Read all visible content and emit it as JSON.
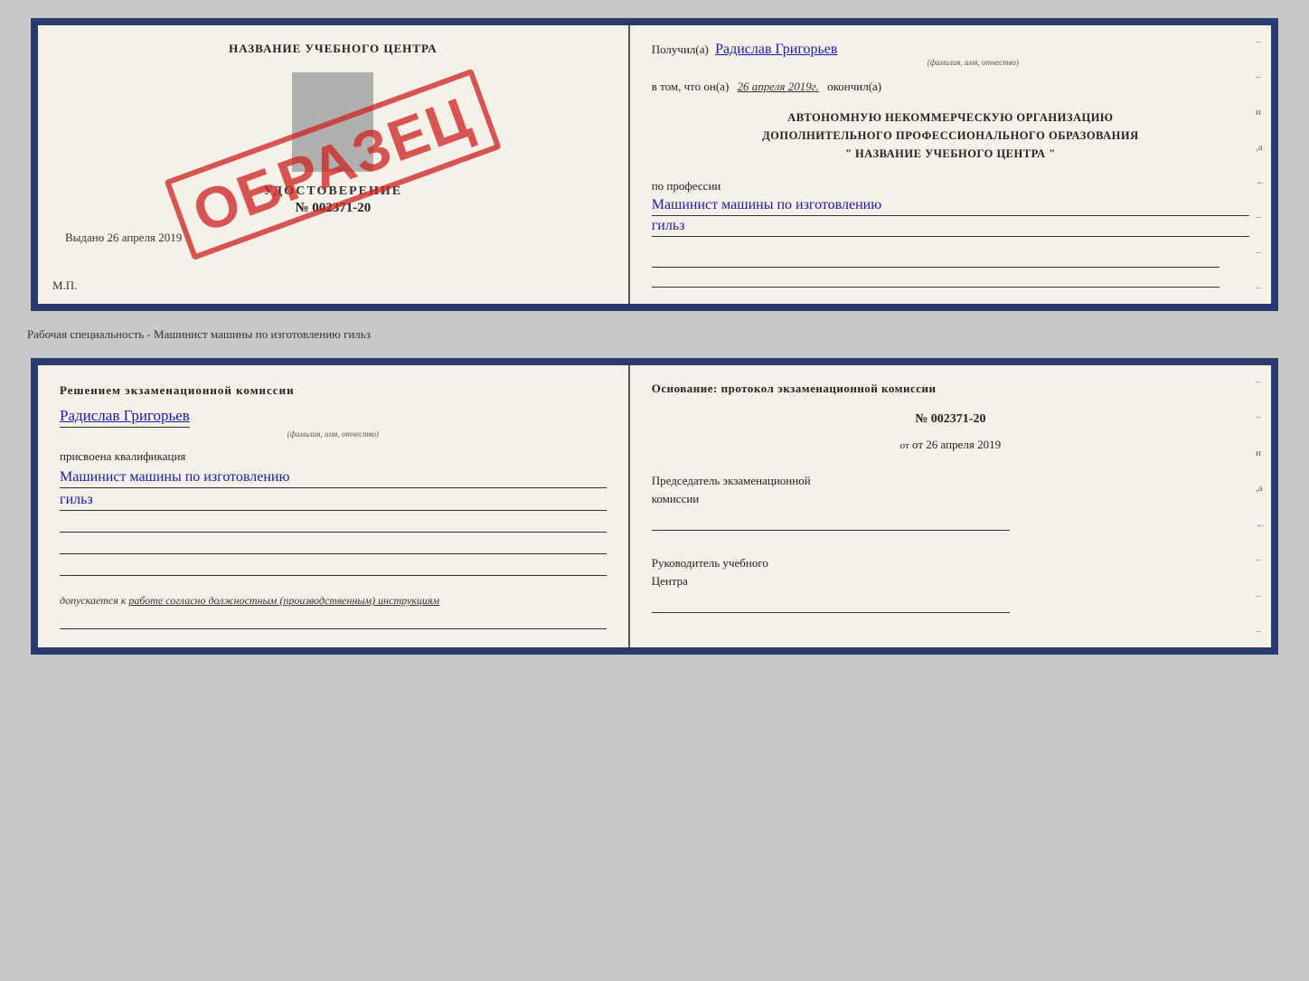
{
  "topDoc": {
    "left": {
      "centerTitle": "НАЗВАНИЕ УЧЕБНОГО ЦЕНТРА",
      "udost": "УДОСТОВЕРЕНИЕ",
      "number": "№ 002371-20",
      "vydano": "Выдано 26 апреля 2019",
      "mp": "М.П.",
      "obrazec": "ОБРАЗЕЦ"
    },
    "right": {
      "poluchilPrefix": "Получил(а)",
      "nameHandwritten": "Радислав Григорьев",
      "nameSub": "(фамилия, имя, отчество)",
      "vtomPrefix": "в том, что он(а)",
      "dateHandwritten": "26 апреля 2019г.",
      "okончил": "окончил(а)",
      "orgLine1": "АВТОНОМНУЮ НЕКОММЕРЧЕСКУЮ ОРГАНИЗАЦИЮ",
      "orgLine2": "ДОПОЛНИТЕЛЬНОГО ПРОФЕССИОНАЛЬНОГО ОБРАЗОВАНИЯ",
      "orgLine3": "\" НАЗВАНИЕ УЧЕБНОГО ЦЕНТРА \"",
      "professiLabel": "по профессии",
      "professiHandwritten": "Машинист машины по изготовлению",
      "professiHandwritten2": "гильз"
    }
  },
  "remarkLabel": "Рабочая специальность - Машинист машины по изготовлению гильз",
  "bottomDoc": {
    "left": {
      "resheniemText": "Решением  экзаменационной  комиссии",
      "nameHandwritten": "Радислав Григорьев",
      "nameSub": "(фамилия, имя, отчество)",
      "prisvoyena": "присвоена квалификация",
      "qualifHandwritten": "Машинист машины по изготовлению",
      "qualifHandwritten2": "гильз",
      "dopuskaetsya": "допускается к",
      "dopuskItalic": "работе согласно должностным (производственным) инструкциям"
    },
    "right": {
      "osnovTitle": "Основание: протокол экзаменационной  комиссии",
      "protocolNumber": "№  002371-20",
      "otDate": "от 26 апреля 2019",
      "predsedatelLabel": "Председатель экзаменационной",
      "predsedatelLabel2": "комиссии",
      "rukovodLabel": "Руководитель учебного",
      "rukovodLabel2": "Центра"
    }
  }
}
